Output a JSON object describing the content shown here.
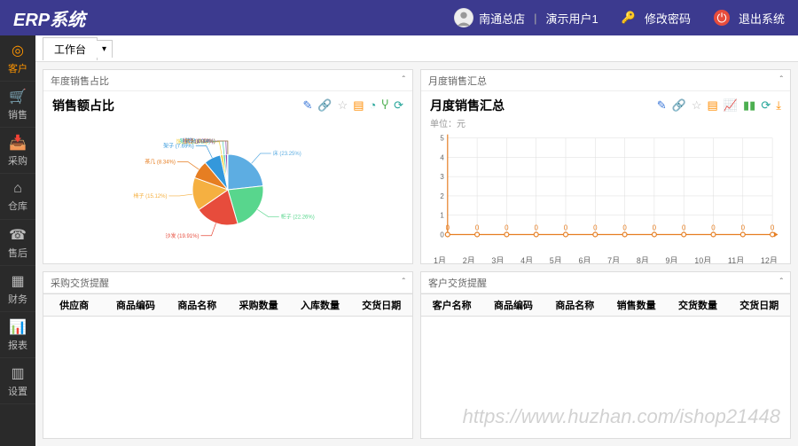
{
  "app": {
    "title": "ERP系统"
  },
  "header": {
    "store": "南通总店",
    "user": "演示用户1",
    "change_pwd": "修改密码",
    "logout": "退出系统"
  },
  "sidebar": {
    "items": [
      {
        "label": "客户",
        "icon": "◎"
      },
      {
        "label": "销售",
        "icon": "🛒"
      },
      {
        "label": "采购",
        "icon": "📥"
      },
      {
        "label": "仓库",
        "icon": "⌂"
      },
      {
        "label": "售后",
        "icon": "☎"
      },
      {
        "label": "财务",
        "icon": "▦"
      },
      {
        "label": "报表",
        "icon": "📊"
      },
      {
        "label": "设置",
        "icon": "▥"
      }
    ]
  },
  "tabs": {
    "workbench": "工作台"
  },
  "panels": {
    "pie": {
      "header": "年度销售占比",
      "title": "销售额占比"
    },
    "line": {
      "header": "月度销售汇总",
      "title": "月度销售汇总",
      "unit": "单位：元"
    },
    "purchase": {
      "header": "采购交货提醒",
      "cols": [
        "供应商",
        "商品编码",
        "商品名称",
        "采购数量",
        "入库数量",
        "交货日期"
      ]
    },
    "customer": {
      "header": "客户交货提醒",
      "cols": [
        "客户名称",
        "商品编码",
        "商品名称",
        "销售数量",
        "交货数量",
        "交货日期"
      ]
    }
  },
  "chart_data": [
    {
      "type": "pie",
      "title": "销售额占比",
      "series": [
        {
          "name": "床",
          "value": 23.25,
          "color": "#5dade2"
        },
        {
          "name": "柜子",
          "value": 22.26,
          "color": "#58d68d"
        },
        {
          "name": "沙发",
          "value": 19.91,
          "color": "#e74c3c"
        },
        {
          "name": "椅子",
          "value": 15.12,
          "color": "#f5b041"
        },
        {
          "name": "茶几",
          "value": 8.34,
          "color": "#e67e22"
        },
        {
          "name": "架子",
          "value": 7.69,
          "color": "#3498db"
        },
        {
          "name": "饰品",
          "value": 1.24,
          "color": "#f4d03f"
        },
        {
          "name": "凳子",
          "value": 1.02,
          "color": "#48c9b0"
        },
        {
          "name": "妆台",
          "value": 1.0,
          "color": "#8e44ad"
        },
        {
          "name": "书架",
          "value": 0.14,
          "color": "#2e86c1"
        },
        {
          "name": "枕头",
          "value": 0.02,
          "color": "#cd853f"
        }
      ]
    },
    {
      "type": "line",
      "title": "月度销售汇总",
      "xlabel": "",
      "ylabel": "",
      "ylim": [
        0,
        5
      ],
      "categories": [
        "1月",
        "2月",
        "3月",
        "4月",
        "5月",
        "6月",
        "7月",
        "8月",
        "9月",
        "10月",
        "11月",
        "12月"
      ],
      "values": [
        0,
        0,
        0,
        0,
        0,
        0,
        0,
        0,
        0,
        0,
        0,
        0
      ],
      "color": "#e67e22"
    }
  ],
  "watermark": "https://www.huzhan.com/ishop21448"
}
